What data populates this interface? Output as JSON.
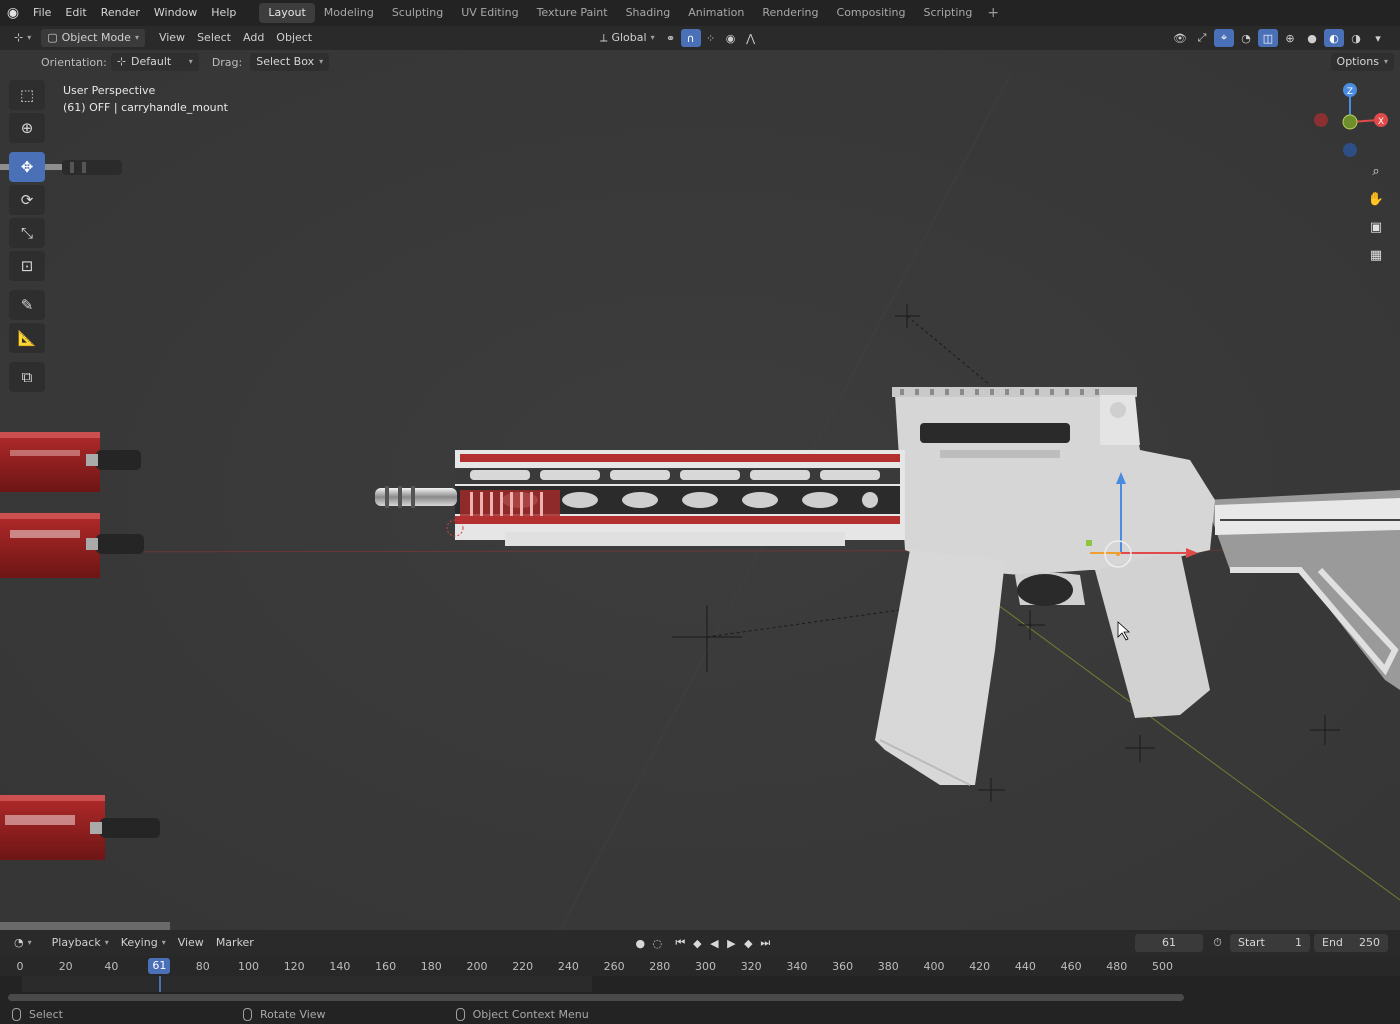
{
  "topbar": {
    "menus": [
      "File",
      "Edit",
      "Render",
      "Window",
      "Help"
    ],
    "workspaces": [
      "Layout",
      "Modeling",
      "Sculpting",
      "UV Editing",
      "Texture Paint",
      "Shading",
      "Animation",
      "Rendering",
      "Compositing",
      "Scripting"
    ],
    "active_workspace": "Layout",
    "add_symbol": "+"
  },
  "header": {
    "mode": "Object Mode",
    "menus": [
      "View",
      "Select",
      "Add",
      "Object"
    ],
    "transform_orientation": "Global"
  },
  "tool_settings": {
    "orientation_label": "Orientation:",
    "orientation_value": "Default",
    "drag_label": "Drag:",
    "drag_value": "Select Box",
    "options_label": "Options"
  },
  "viewport": {
    "perspective": "User Perspective",
    "object_info": "(61) OFF | carryhandle_mount",
    "gizmo": {
      "z": "Z",
      "x": "X"
    }
  },
  "toolbar": {
    "tools": [
      "select-box",
      "cursor",
      "move",
      "rotate",
      "scale",
      "transform",
      "annotate",
      "measure",
      "add-cube"
    ],
    "active_tool": "move"
  },
  "timeline": {
    "menus": [
      "Playback",
      "Keying",
      "View",
      "Marker"
    ],
    "current_frame": "61",
    "start_label": "Start",
    "start_value": "1",
    "end_label": "End",
    "end_value": "250",
    "ticks": [
      "0",
      "20",
      "40",
      "61",
      "80",
      "100",
      "120",
      "140",
      "160",
      "180",
      "200",
      "220",
      "240",
      "260",
      "280",
      "300",
      "320",
      "340",
      "360",
      "380",
      "400",
      "420",
      "440",
      "460",
      "480",
      "500"
    ]
  },
  "statusbar": {
    "left": "Select",
    "middle": "Rotate View",
    "right": "Object Context Menu"
  },
  "colors": {
    "accent": "#4a70b8",
    "axis_x": "#e04a4a",
    "axis_y": "#8cc63f",
    "axis_z": "#4a8ce0"
  }
}
